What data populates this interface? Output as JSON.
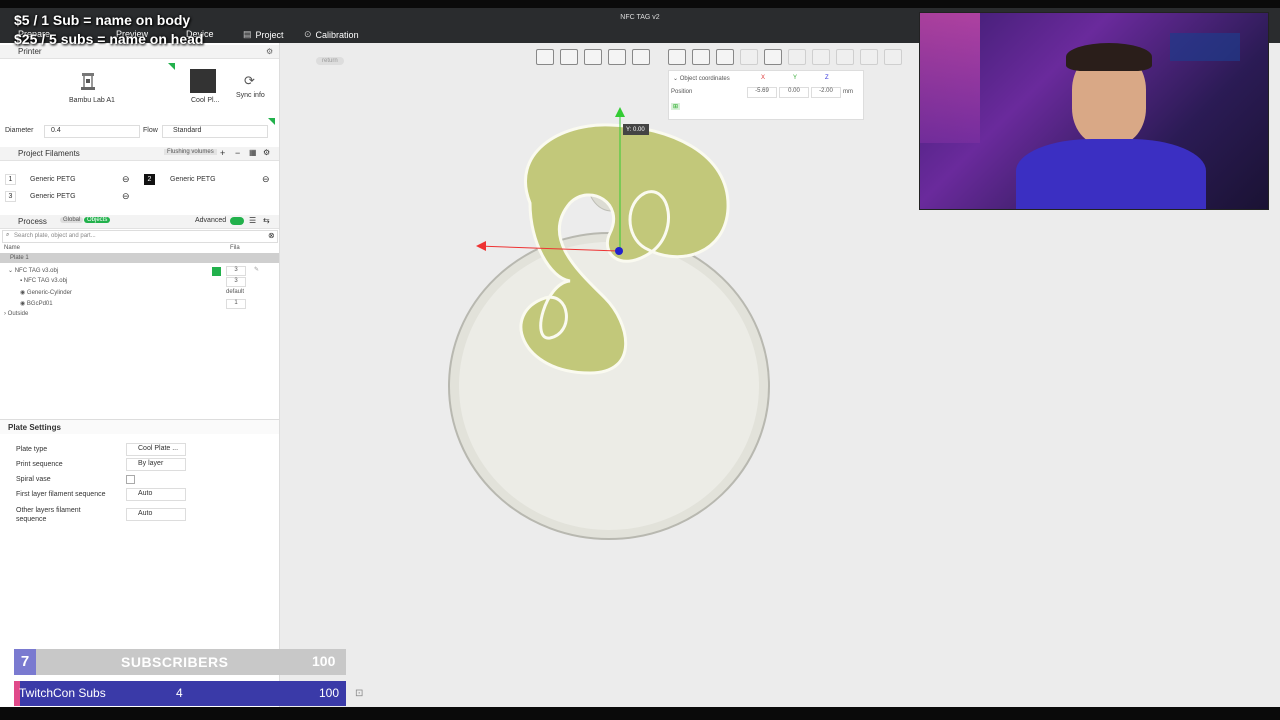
{
  "app": {
    "window_title": "NFC TAG v2",
    "tabs": [
      {
        "label": "Prepare"
      },
      {
        "label": "Preview"
      },
      {
        "label": "Device"
      },
      {
        "label": "Project"
      },
      {
        "label": "Calibration"
      }
    ]
  },
  "stream_overlay": {
    "line1": "$5 / 1 Sub = name on body",
    "line2": "$25 / 5 subs = name on head"
  },
  "printer": {
    "section_title": "Printer",
    "name": "Bambu Lab A1",
    "plate": "Cool Pl...",
    "sync_label": "Sync info",
    "diameter_label": "Diameter",
    "diameter_value": "0.4",
    "flow_label": "Flow",
    "flow_value": "Standard"
  },
  "filaments": {
    "section_title": "Project Filaments",
    "flushing_label": "Flushing volumes",
    "items": [
      {
        "index": "1",
        "name": "Generic PETG"
      },
      {
        "index": "2",
        "name": "Generic PETG"
      },
      {
        "index": "3",
        "name": "Generic PETG"
      }
    ]
  },
  "process": {
    "section_title": "Process",
    "global_label": "Global",
    "objects_label": "Objects",
    "advanced_label": "Advanced",
    "search_placeholder": "Search plate, object and part...",
    "col_name": "Name",
    "col_fila": "Fila",
    "tree": {
      "plate": "Plate 1",
      "object": "NFC TAG v3.obj",
      "object_fila": "3",
      "part1": "NFC TAG v3.obj",
      "part1_fila": "3",
      "part2": "Generic-Cylinder",
      "part2_fila": "default",
      "part3": "BGcPd01",
      "part3_fila": "1",
      "outside": "Outside"
    }
  },
  "plate_settings": {
    "title": "Plate Settings",
    "rows": [
      {
        "label": "Plate type",
        "value": "Cool Plate ..."
      },
      {
        "label": "Print sequence",
        "value": "By layer"
      },
      {
        "label": "Spiral vase",
        "value": ""
      },
      {
        "label": "First layer filament sequence",
        "value": "Auto"
      },
      {
        "label": "Other layers filament sequence",
        "value": "Auto"
      }
    ]
  },
  "viewport": {
    "return_label": "return",
    "coord_title": "Object coordinates",
    "axis_x": "X",
    "axis_y": "Y",
    "axis_z": "Z",
    "position_label": "Position",
    "pos_x": "-5.69",
    "pos_y": "0.00",
    "pos_z": "-2.00",
    "unit": "mm",
    "y_readout": "Y: 0.00"
  },
  "subs_goal": {
    "current": "7",
    "label": "SUBSCRIBERS",
    "max": "100",
    "progress": 0.07
  },
  "twitchcon": {
    "label": "TwitchCon Subs",
    "current": "4",
    "max": "100",
    "progress": 0.04
  },
  "colors": {
    "model_green": "#c2c87a",
    "model_base": "#e6e6de",
    "accent_green": "#22b14c",
    "topbar": "#2a2c2e"
  }
}
